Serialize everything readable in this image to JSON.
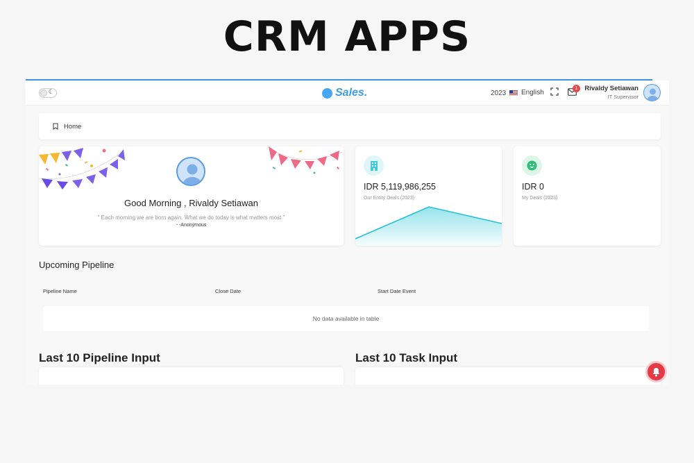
{
  "hero": {
    "title": "CRM APPS"
  },
  "navbar": {
    "brand": "Sales.",
    "year": "2023",
    "language": "English",
    "mail_count": "1",
    "user_name": "Rivaldy Setiawan",
    "user_role": "IT Supervisor",
    "icons": [
      "theme-toggle",
      "flag-us",
      "fullscreen-icon",
      "mail-icon",
      "avatar"
    ]
  },
  "breadcrumb": {
    "label": "Home"
  },
  "welcome": {
    "greeting": "Good Morning , Rivaldy Setiawan",
    "quote": "\" Each morning we are born again. What we do today is what matters most \"",
    "author": "- -Anonymous"
  },
  "stats": [
    {
      "value": "IDR 5,119,986,255",
      "label": "Our Entity Deals (2023)",
      "icon": "building-icon",
      "color": "#3ccbd9"
    },
    {
      "value": "IDR 0",
      "label": "My Deals (2023)",
      "icon": "smile-icon",
      "color": "#2dbf73"
    }
  ],
  "pipeline": {
    "title": "Upcoming Pipeline",
    "columns": [
      "Pipeline Name",
      "Close Date",
      "Start Date Event"
    ],
    "empty_text": "No data available in table"
  },
  "last_pipeline": {
    "title": "Last 10 Pipeline Input"
  },
  "last_task": {
    "title": "Last 10 Task Input"
  },
  "colors": {
    "accent": "#3b93e6",
    "alert": "#e63946"
  }
}
